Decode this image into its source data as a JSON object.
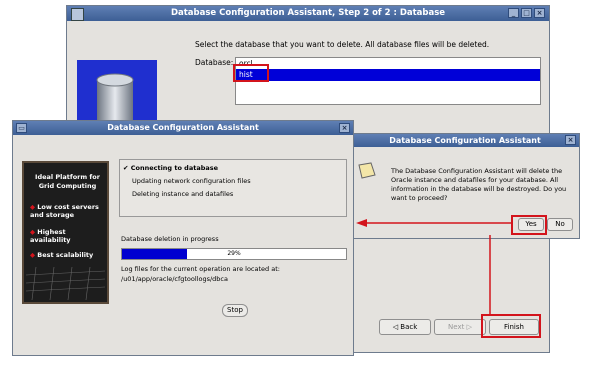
{
  "main": {
    "title": "Database Configuration Assistant, Step 2 of 2 : Database",
    "instruction": "Select the database that you want to delete. All database files will be deleted.",
    "db_label": "Database:",
    "databases": [
      "orcl",
      "hist"
    ],
    "selected": "hist",
    "back_label": "Back",
    "next_label": "Next",
    "finish_label": "Finish"
  },
  "progress": {
    "title": "Database Configuration Assistant",
    "side_panel": {
      "heading": "Ideal Platform for Grid Computing",
      "bullets": [
        "Low cost servers and storage",
        "Highest availability",
        "Best scalability"
      ]
    },
    "steps": [
      "Connecting to database",
      "Updating network configuration files",
      "Deleting instance and datafiles"
    ],
    "status_text": "Database deletion in progress",
    "percent_text": "29%",
    "percent": 29,
    "log_text": "Log files for the current operation are located at:",
    "log_path": "/u01/app/oracle/cfgtoollogs/dbca",
    "stop_label": "Stop"
  },
  "confirm": {
    "title": "Database Configuration Assistant",
    "message": "The Database Configuration Assistant will delete the Oracle instance and datafiles for your database. All information in the database will be destroyed. Do you want to proceed?",
    "yes_label": "Yes",
    "no_label": "No"
  },
  "colors": {
    "highlight": "#d3141c",
    "titlebar": "#4a6aa0",
    "selection": "#0000d8"
  }
}
